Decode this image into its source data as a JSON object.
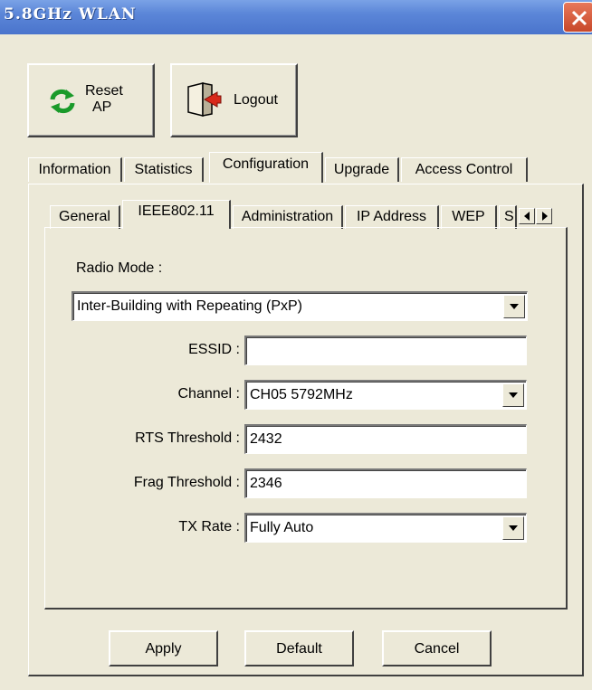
{
  "window": {
    "title": "5.8GHz WLAN"
  },
  "toolbar": {
    "reset_label_line1": "Reset",
    "reset_label_line2": "AP",
    "logout_label": "Logout"
  },
  "main_tabs": [
    {
      "label": "Information"
    },
    {
      "label": "Statistics"
    },
    {
      "label": "Configuration"
    },
    {
      "label": "Upgrade"
    },
    {
      "label": "Access Control"
    }
  ],
  "sub_tabs": [
    {
      "label": "General"
    },
    {
      "label": "IEEE802.11"
    },
    {
      "label": "Administration"
    },
    {
      "label": "IP Address"
    },
    {
      "label": "WEP"
    },
    {
      "label": "S"
    }
  ],
  "form": {
    "radio_mode_label": "Radio Mode :",
    "radio_mode_value": "Inter-Building with Repeating (PxP)",
    "essid_label": "ESSID :",
    "essid_value": "",
    "channel_label": "Channel :",
    "channel_value": "CH05 5792MHz",
    "rts_label": "RTS Threshold :",
    "rts_value": "2432",
    "frag_label": "Frag Threshold :",
    "frag_value": "2346",
    "txrate_label": "TX Rate :",
    "txrate_value": "Fully Auto"
  },
  "buttons": {
    "apply": "Apply",
    "default": "Default",
    "cancel": "Cancel"
  },
  "icons": {
    "reset": "refresh-arrows-icon",
    "logout": "door-exit-icon",
    "close": "close-icon"
  },
  "colors": {
    "title_bar": "#5b86d8",
    "window_bg": "#ece9d8",
    "refresh_green": "#1a9a2a",
    "logout_red": "#d8281a"
  }
}
